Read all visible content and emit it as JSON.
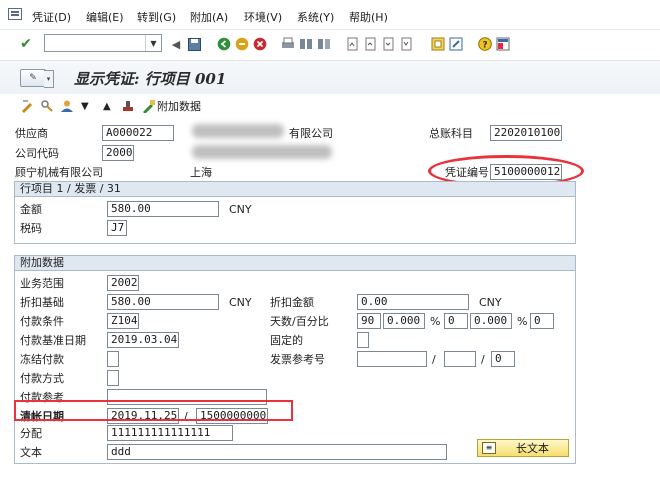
{
  "menu": [
    "凭证(D)",
    "编辑(E)",
    "转到(G)",
    "附加(A)",
    "环境(V)",
    "系统(Y)",
    "帮助(H)"
  ],
  "title": "显示凭证: 行项目 001",
  "app_toolbar": {
    "additional_data": "附加数据"
  },
  "header": {
    "vendor_label": "供应商",
    "vendor_value": "A000022",
    "company_suffix": "有限公司",
    "gl_label": "总账科目",
    "gl_value": "2202010100",
    "company_code_label": "公司代码",
    "company_code_value": "2000",
    "company_name": "顾宁机械有限公司",
    "city": "上海",
    "doc_no_label": "凭证编号",
    "doc_no_value": "5100000012"
  },
  "line_item": {
    "title": "行项目 1 / 发票 / 31",
    "amount_label": "金额",
    "amount_value": "580.00",
    "currency": "CNY",
    "tax_code_label": "税码",
    "tax_code_value": "J7"
  },
  "additional": {
    "title": "附加数据",
    "business_area_label": "业务范围",
    "business_area_value": "2002",
    "discount_base_label": "折扣基础",
    "discount_base_value": "580.00",
    "discount_base_currency": "CNY",
    "discount_amount_label": "折扣金额",
    "discount_amount_value": "0.00",
    "discount_amount_currency": "CNY",
    "payment_terms_label": "付款条件",
    "payment_terms_value": "Z104",
    "days_pct_label": "天数/百分比",
    "days1": "90",
    "pct1": "0.000",
    "pct_sign": "%",
    "days2": "0",
    "pct2": "0.000",
    "days3": "0",
    "baseline_date_label": "付款基准日期",
    "baseline_date_value": "2019.03.04",
    "fixed_label": "固定的",
    "payment_block_label": "冻结付款",
    "invoice_ref_label": "发票参考号",
    "slash": "/",
    "invoice_ref_tail": "0",
    "payment_method_label": "付款方式",
    "payment_ref_label": "付款参考",
    "clearing_label": "清帐日期",
    "clearing_date": "2019.11.25",
    "clearing_doc": "1500000000",
    "assignment_label": "分配",
    "assignment_value": "111111111111111",
    "text_label": "文本",
    "text_value": "ddd",
    "longtext_button": "长文本"
  }
}
